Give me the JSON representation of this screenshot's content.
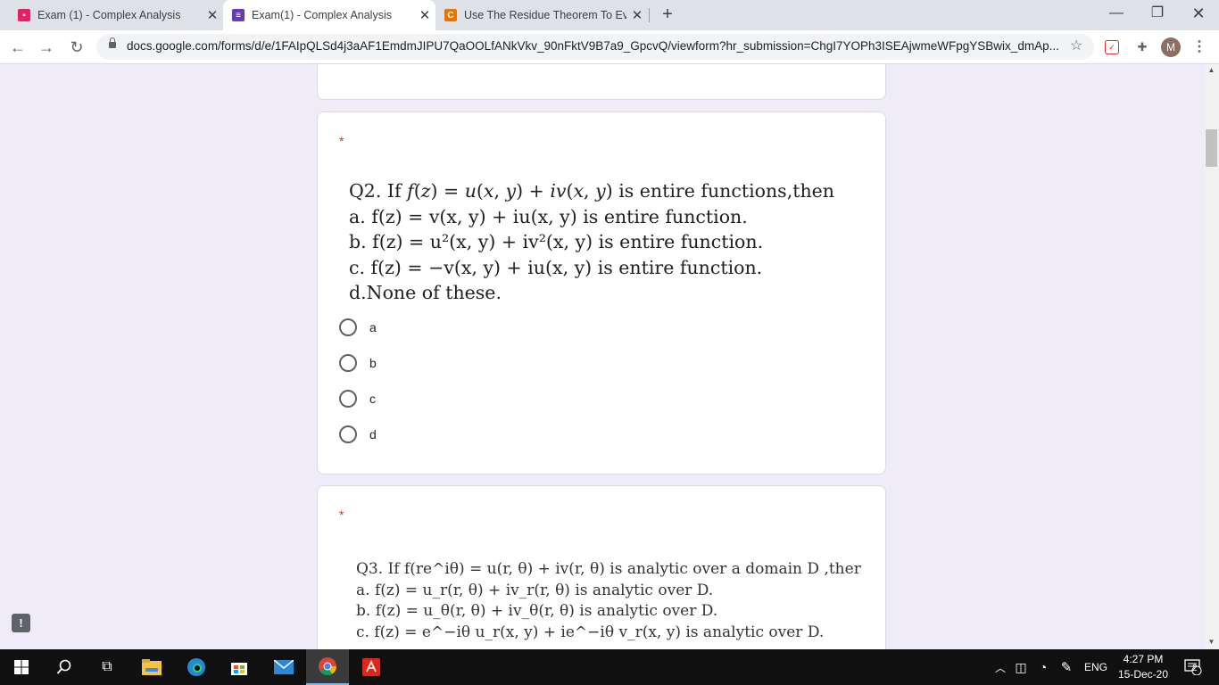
{
  "browser": {
    "tabs": [
      {
        "title": "Exam (1) - Complex Analysis",
        "favicon": "classroom-icon",
        "color": "#e91e63",
        "active": false
      },
      {
        "title": "Exam(1) - Complex Analysis",
        "favicon": "forms-icon",
        "color": "#673ab7",
        "active": true
      },
      {
        "title": "Use The Residue Theorem To Eva",
        "favicon": "chegg-icon",
        "color": "#eb7100",
        "active": false
      }
    ],
    "new_tab": "+",
    "url": "docs.google.com/forms/d/e/1FAIpQLSd4j3aAF1EmdmJIPU7QaOOLfANkVkv_90nFktV9B7a9_GpcvQ/viewform?hr_submission=ChgI7YOPh3ISEAjwmeWFpgYSBwix_dmAp...",
    "avatar_letter": "M"
  },
  "form": {
    "required_mark": "*",
    "q2": {
      "stem_html": "Q2. If <span class='mi'>f</span>(<span class='mi'>z</span>) = <span class='mi'>u</span>(<span class='mi'>x</span>, <span class='mi'>y</span>) + <span class='mi'>iv</span>(<span class='mi'>x</span>, <span class='mi'>y</span>) is entire functions,then",
      "lines": [
        "a. f(z) = v(x, y) + iu(x, y) is entire function.",
        "b. f(z) = u²(x, y) + iv²(x, y) is entire function.",
        "c. f(z) = −v(x, y) + iu(x, y) is entire function.",
        "d.None of these."
      ],
      "options": [
        "a",
        "b",
        "c",
        "d"
      ]
    },
    "q3": {
      "lines": [
        "Q3. If f(re^iθ) = u(r, θ) + iv(r, θ) is analytic over a domain D ,ther",
        "a. f(z) = u_r(r, θ) + iv_r(r, θ) is analytic over D.",
        "b. f(z) = u_θ(r, θ) + iv_θ(r, θ) is analytic over D.",
        "c. f(z) = e^−iθ u_r(x, y) + ie^−iθ v_r(x, y) is analytic over D."
      ]
    }
  },
  "taskbar": {
    "language": "ENG",
    "time": "4:27 PM",
    "date": "15-Dec-20",
    "notifications": "2"
  }
}
